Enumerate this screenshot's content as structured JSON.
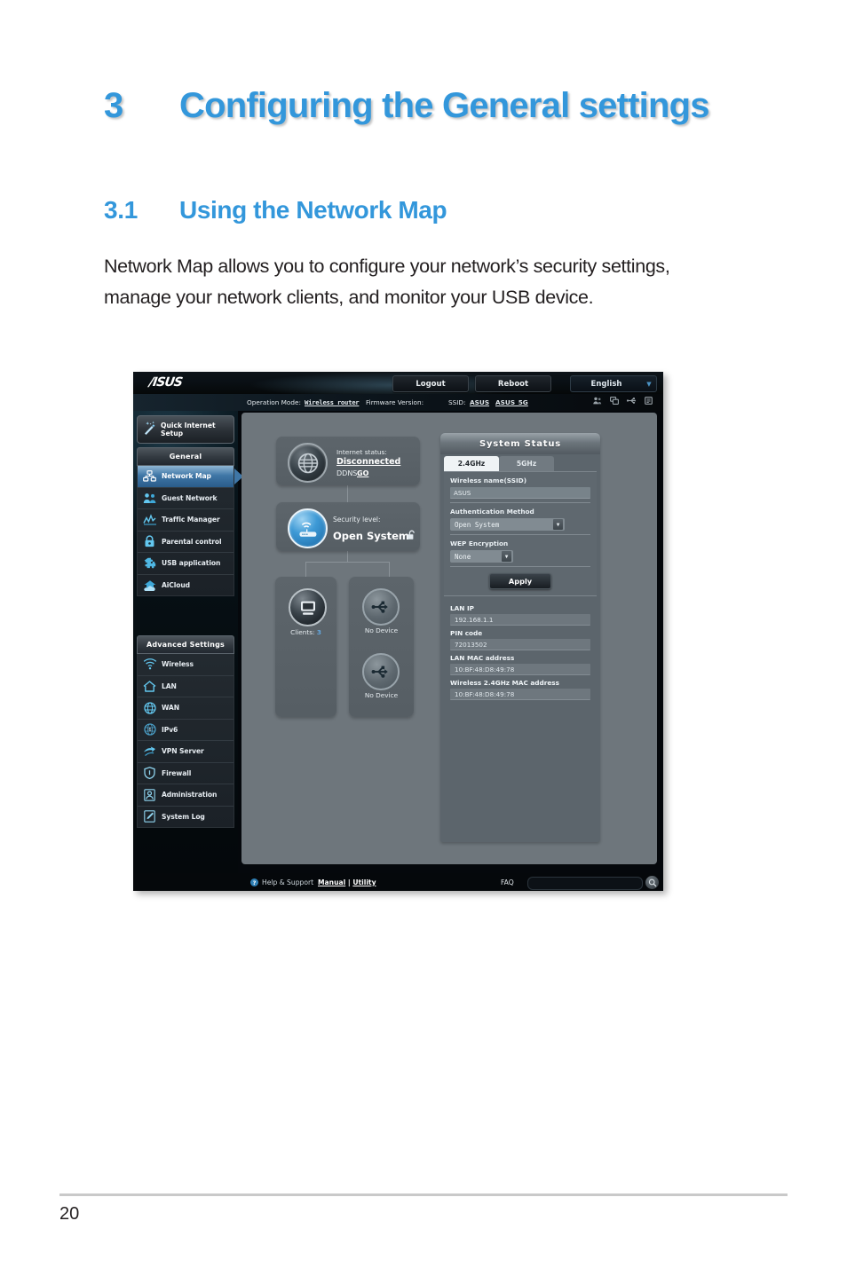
{
  "document": {
    "chapter_number": "3",
    "chapter_title": "Configuring the General settings",
    "section_number": "3.1",
    "section_title": "Using the Network Map",
    "body_paragraph": "Network Map allows you to configure your network’s security settings, manage your network clients, and monitor your USB device.",
    "page_number": "20",
    "heading_color": "#3397db"
  },
  "router_ui": {
    "brand": "/ISUS",
    "top_bar": {
      "logout_label": "Logout",
      "reboot_label": "Reboot",
      "language": "English",
      "caret": "▼"
    },
    "info_bar": {
      "operation_mode_label": "Operation Mode:",
      "operation_mode_value": "Wireless router",
      "firmware_label": "Firmware Version:",
      "firmware_value": "",
      "ssid_label": "SSID:",
      "ssid_1": "ASUS",
      "ssid_2": "ASUS_5G",
      "icons": [
        "users-icon",
        "clients-icon",
        "usb-icon",
        "syslog-icon"
      ]
    },
    "sidebar": {
      "quick_setup": {
        "label_line1": "Quick Internet",
        "label_line2": "Setup",
        "icon": "magic-wand-icon"
      },
      "general_header": "General",
      "general_items": [
        {
          "label": "Network Map",
          "icon": "network-map-icon",
          "active": true
        },
        {
          "label": "Guest Network",
          "icon": "guest-network-icon",
          "active": false
        },
        {
          "label": "Traffic Manager",
          "icon": "traffic-manager-icon",
          "active": false
        },
        {
          "label": "Parental control",
          "icon": "lock-icon",
          "active": false
        },
        {
          "label": "USB application",
          "icon": "puzzle-icon",
          "active": false
        },
        {
          "label": "AiCloud",
          "icon": "cloud-icon",
          "active": false
        }
      ],
      "advanced_header": "Advanced Settings",
      "advanced_items": [
        {
          "label": "Wireless",
          "icon": "wifi-icon"
        },
        {
          "label": "LAN",
          "icon": "home-icon"
        },
        {
          "label": "WAN",
          "icon": "globe-icon"
        },
        {
          "label": "IPv6",
          "icon": "ipv6-icon"
        },
        {
          "label": "VPN Server",
          "icon": "vpn-icon"
        },
        {
          "label": "Firewall",
          "icon": "shield-icon"
        },
        {
          "label": "Administration",
          "icon": "admin-user-icon"
        },
        {
          "label": "System Log",
          "icon": "system-log-icon"
        }
      ]
    },
    "network_map": {
      "internet": {
        "status_label": "Internet status:",
        "status_value": "Disconnected",
        "ddns_label": "DDNS:",
        "ddns_value": "GO",
        "icon": "globe-icon"
      },
      "security": {
        "level_label": "Security level:",
        "level_value": "Open System",
        "lock_icon": "open-padlock-icon",
        "icon": "router-icon"
      },
      "clients": {
        "caption_label": "Clients:",
        "count": "3",
        "icon": "monitor-icon"
      },
      "usb": {
        "slot1_label": "No Device",
        "slot2_label": "No Device",
        "icon": "usb-icon"
      }
    },
    "system_status": {
      "title": "System Status",
      "tabs": [
        {
          "label": "2.4GHz",
          "selected": true
        },
        {
          "label": "5GHz",
          "selected": false
        }
      ],
      "ssid_label": "Wireless name(SSID)",
      "ssid_value": "ASUS",
      "auth_label": "Authentication Method",
      "auth_value": "Open System",
      "wep_label": "WEP Encryption",
      "wep_value": "None",
      "apply_label": "Apply",
      "readonly_fields": [
        {
          "label": "LAN IP",
          "value": "192.168.1.1"
        },
        {
          "label": "PIN code",
          "value": "72013502"
        },
        {
          "label": "LAN MAC address",
          "value": "10:BF:48:D8:49:78"
        },
        {
          "label": "Wireless 2.4GHz MAC address",
          "value": "10:BF:48:D8:49:78"
        }
      ]
    },
    "footer": {
      "help_label": "Help & Support",
      "manual_label": "Manual",
      "divider": "|",
      "utility_label": "Utility",
      "faq_label": "FAQ",
      "search_value": "",
      "search_icon": "magnifier-icon"
    }
  }
}
